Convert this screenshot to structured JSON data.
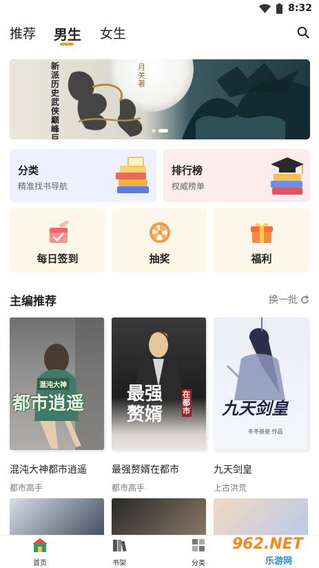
{
  "status": {
    "time": "8:32"
  },
  "tabs": [
    {
      "label": "推荐"
    },
    {
      "label": "男生"
    },
    {
      "label": "女生"
    }
  ],
  "banner": {
    "vertical_text": "新派历史武侠巅峰巨",
    "author_text": "月关 著",
    "title_art": "锦衣夜行"
  },
  "cards": [
    {
      "title": "分类",
      "subtitle": "精准找书导航",
      "bg": "#eef0fd"
    },
    {
      "title": "排行榜",
      "subtitle": "权威榜单",
      "bg": "#fdeced"
    }
  ],
  "features": [
    {
      "label": "每日签到",
      "icon": "checkin-icon"
    },
    {
      "label": "抽奖",
      "icon": "lottery-wheel-icon"
    },
    {
      "label": "福利",
      "icon": "gift-icon"
    }
  ],
  "section": {
    "title": "主编推荐",
    "refresh_label": "换一批"
  },
  "books": [
    {
      "name": "混沌大神都市逍遥",
      "genre": "都市高手",
      "cover_text": "都市逍遥",
      "cover_sub": "混沌大神"
    },
    {
      "name": "最强赘婿在都市",
      "genre": "都市高手",
      "cover_text": "最强赘婿",
      "cover_sub": "在都市"
    },
    {
      "name": "九天剑皇",
      "genre": "上古洪荒",
      "cover_text": "九天剑皇",
      "cover_sub": "冬冬爸爸 作品"
    }
  ],
  "bottom_nav": [
    {
      "label": "首页",
      "icon": "home-icon"
    },
    {
      "label": "书架",
      "icon": "bookshelf-icon"
    },
    {
      "label": "分类",
      "icon": "category-icon"
    }
  ],
  "watermark": {
    "text": "962.NET",
    "sub": "乐游网"
  },
  "colors": {
    "accent": "#ff9a1f",
    "feature_bg": "#fdf7ea"
  }
}
